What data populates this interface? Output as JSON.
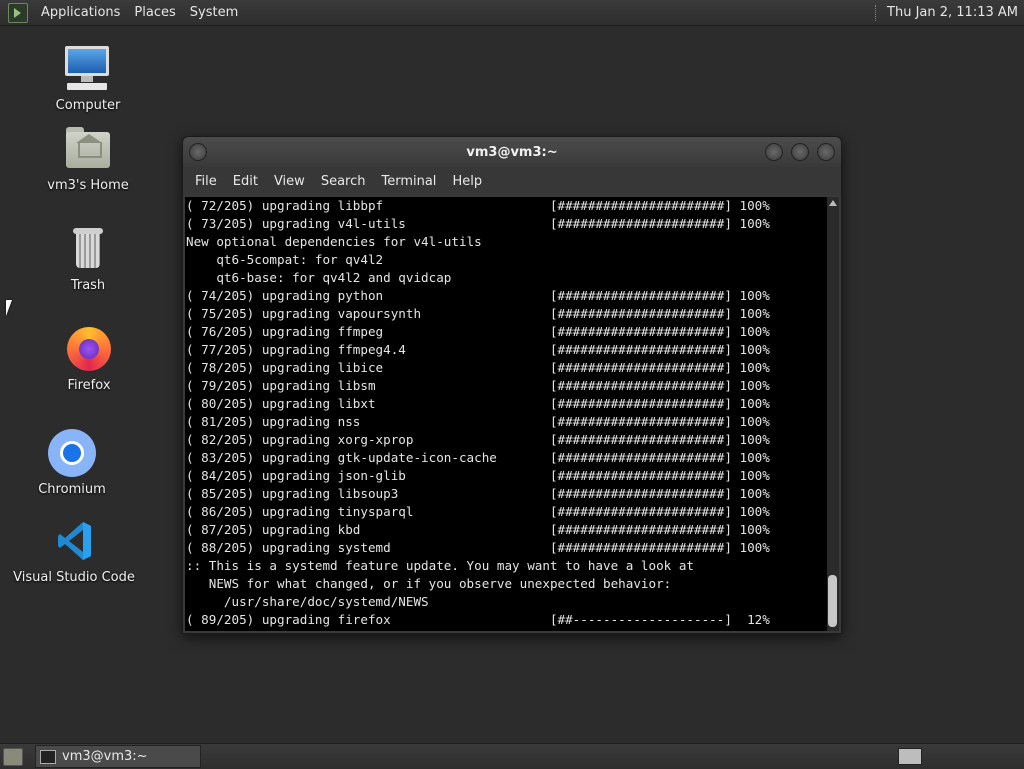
{
  "top_panel": {
    "menus": [
      "Applications",
      "Places",
      "System"
    ],
    "clock": "Thu Jan  2, 11:13 AM"
  },
  "desktop_icons": [
    {
      "label": "Computer",
      "icon": "computer-icon"
    },
    {
      "label": "vm3's Home",
      "icon": "home-folder-icon"
    },
    {
      "label": "Trash",
      "icon": "trash-icon"
    },
    {
      "label": "Firefox",
      "icon": "firefox-icon"
    },
    {
      "label": "Chromium",
      "icon": "chromium-icon"
    },
    {
      "label": "Visual Studio Code",
      "icon": "vscode-icon"
    }
  ],
  "terminal": {
    "title": "vm3@vm3:~",
    "menu": [
      "File",
      "Edit",
      "View",
      "Search",
      "Terminal",
      "Help"
    ],
    "lines": [
      "( 72/205) upgrading libbpf                      [######################] 100%",
      "( 73/205) upgrading v4l-utils                   [######################] 100%",
      "New optional dependencies for v4l-utils",
      "    qt6-5compat: for qv4l2",
      "    qt6-base: for qv4l2 and qvidcap",
      "( 74/205) upgrading python                      [######################] 100%",
      "( 75/205) upgrading vapoursynth                 [######################] 100%",
      "( 76/205) upgrading ffmpeg                      [######################] 100%",
      "( 77/205) upgrading ffmpeg4.4                   [######################] 100%",
      "( 78/205) upgrading libice                      [######################] 100%",
      "( 79/205) upgrading libsm                       [######################] 100%",
      "( 80/205) upgrading libxt                       [######################] 100%",
      "( 81/205) upgrading nss                         [######################] 100%",
      "( 82/205) upgrading xorg-xprop                  [######################] 100%",
      "( 83/205) upgrading gtk-update-icon-cache       [######################] 100%",
      "( 84/205) upgrading json-glib                   [######################] 100%",
      "( 85/205) upgrading libsoup3                    [######################] 100%",
      "( 86/205) upgrading tinysparql                  [######################] 100%",
      "( 87/205) upgrading kbd                         [######################] 100%",
      "( 88/205) upgrading systemd                     [######################] 100%",
      ":: This is a systemd feature update. You may want to have a look at",
      "   NEWS for what changed, or if you observe unexpected behavior:",
      "     /usr/share/doc/systemd/NEWS",
      "( 89/205) upgrading firefox                     [##--------------------]  12%"
    ]
  },
  "taskbar": {
    "window_button": "vm3@vm3:~"
  }
}
